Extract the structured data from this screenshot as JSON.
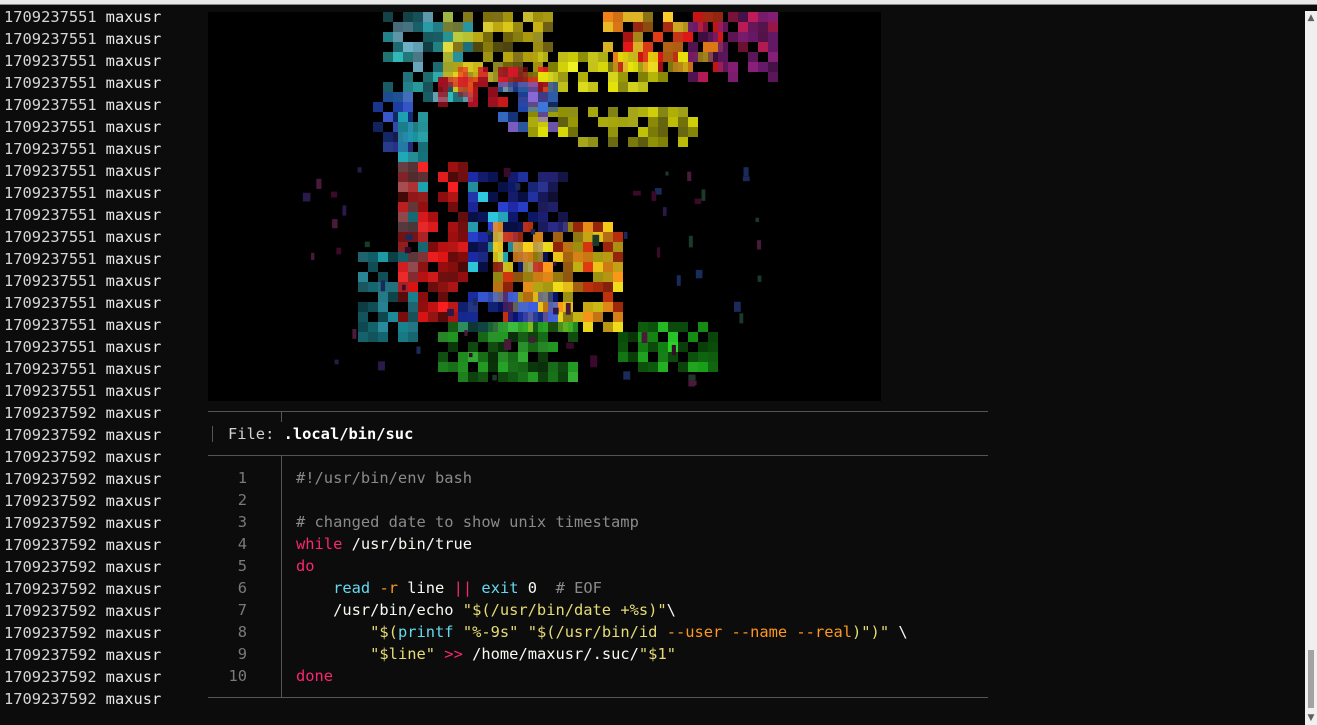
{
  "log": {
    "rows": [
      {
        "ts": "1709237551",
        "user": "maxusr"
      },
      {
        "ts": "1709237551",
        "user": "maxusr"
      },
      {
        "ts": "1709237551",
        "user": "maxusr"
      },
      {
        "ts": "1709237551",
        "user": "maxusr"
      },
      {
        "ts": "1709237551",
        "user": "maxusr"
      },
      {
        "ts": "1709237551",
        "user": "maxusr"
      },
      {
        "ts": "1709237551",
        "user": "maxusr"
      },
      {
        "ts": "1709237551",
        "user": "maxusr"
      },
      {
        "ts": "1709237551",
        "user": "maxusr"
      },
      {
        "ts": "1709237551",
        "user": "maxusr"
      },
      {
        "ts": "1709237551",
        "user": "maxusr"
      },
      {
        "ts": "1709237551",
        "user": "maxusr"
      },
      {
        "ts": "1709237551",
        "user": "maxusr"
      },
      {
        "ts": "1709237551",
        "user": "maxusr"
      },
      {
        "ts": "1709237551",
        "user": "maxusr"
      },
      {
        "ts": "1709237551",
        "user": "maxusr"
      },
      {
        "ts": "1709237551",
        "user": "maxusr"
      },
      {
        "ts": "1709237551",
        "user": "maxusr"
      },
      {
        "ts": "1709237592",
        "user": "maxusr"
      },
      {
        "ts": "1709237592",
        "user": "maxusr"
      },
      {
        "ts": "1709237592",
        "user": "maxusr"
      },
      {
        "ts": "1709237592",
        "user": "maxusr"
      },
      {
        "ts": "1709237592",
        "user": "maxusr"
      },
      {
        "ts": "1709237592",
        "user": "maxusr"
      },
      {
        "ts": "1709237592",
        "user": "maxusr"
      },
      {
        "ts": "1709237592",
        "user": "maxusr"
      },
      {
        "ts": "1709237592",
        "user": "maxusr"
      },
      {
        "ts": "1709237592",
        "user": "maxusr"
      },
      {
        "ts": "1709237592",
        "user": "maxusr"
      },
      {
        "ts": "1709237592",
        "user": "maxusr"
      },
      {
        "ts": "1709237592",
        "user": "maxusr"
      },
      {
        "ts": "1709237592",
        "user": "maxusr"
      }
    ]
  },
  "viewer": {
    "file_label": "File: ",
    "file_name": ".local/bin/suc",
    "lines": [
      {
        "n": "1",
        "tokens": [
          {
            "t": "#!/usr/bin/env bash",
            "c": "comment"
          }
        ]
      },
      {
        "n": "2",
        "tokens": []
      },
      {
        "n": "3",
        "tokens": [
          {
            "t": "# changed date to show unix timestamp",
            "c": "comment"
          }
        ]
      },
      {
        "n": "4",
        "tokens": [
          {
            "t": "while",
            "c": "kw"
          },
          {
            "t": " /usr/bin/true",
            "c": "plain"
          }
        ]
      },
      {
        "n": "5",
        "tokens": [
          {
            "t": "do",
            "c": "kw"
          }
        ]
      },
      {
        "n": "6",
        "tokens": [
          {
            "t": "    ",
            "c": "plain"
          },
          {
            "t": "read",
            "c": "cmd"
          },
          {
            "t": " ",
            "c": "plain"
          },
          {
            "t": "-r",
            "c": "opt"
          },
          {
            "t": " line ",
            "c": "plain"
          },
          {
            "t": "||",
            "c": "kw"
          },
          {
            "t": " ",
            "c": "plain"
          },
          {
            "t": "exit",
            "c": "cmd"
          },
          {
            "t": " 0  ",
            "c": "plain"
          },
          {
            "t": "# EOF",
            "c": "comment"
          }
        ]
      },
      {
        "n": "7",
        "tokens": [
          {
            "t": "    /usr/bin/echo ",
            "c": "plain"
          },
          {
            "t": "\"$(/usr/bin/date +%s)\"",
            "c": "str"
          },
          {
            "t": "\\",
            "c": "plain"
          }
        ]
      },
      {
        "n": "8",
        "tokens": [
          {
            "t": "        ",
            "c": "plain"
          },
          {
            "t": "\"$(",
            "c": "str"
          },
          {
            "t": "printf",
            "c": "cmd"
          },
          {
            "t": " \"%-9s\" \"$(/usr/bin/id ",
            "c": "str"
          },
          {
            "t": "--user --name --real",
            "c": "opt"
          },
          {
            "t": ")\")\"",
            "c": "str"
          },
          {
            "t": " \\",
            "c": "plain"
          }
        ]
      },
      {
        "n": "9",
        "tokens": [
          {
            "t": "        ",
            "c": "plain"
          },
          {
            "t": "\"$line\"",
            "c": "str"
          },
          {
            "t": " ",
            "c": "plain"
          },
          {
            "t": ">>",
            "c": "kw"
          },
          {
            "t": " /home/maxusr/.suc/",
            "c": "plain"
          },
          {
            "t": "\"$1\"",
            "c": "str"
          }
        ]
      },
      {
        "n": "10",
        "tokens": [
          {
            "t": "done",
            "c": "kw"
          }
        ]
      }
    ]
  },
  "colors": {
    "background": "#0c0c0c",
    "comment": "#8a8a8a",
    "keyword": "#f92672",
    "command": "#66d9ef",
    "string": "#e6db74",
    "option": "#fd971f"
  }
}
